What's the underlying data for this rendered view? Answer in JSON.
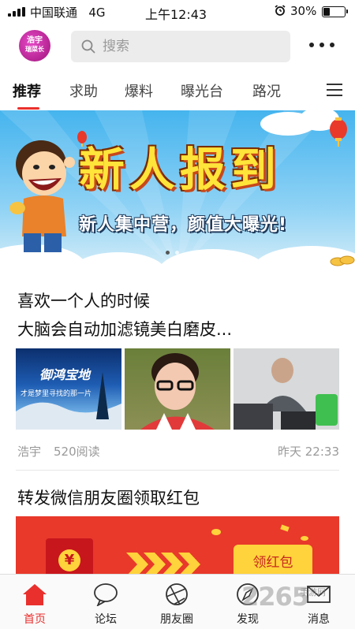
{
  "status_bar": {
    "carrier": "中国联通",
    "network": "4G",
    "time": "上午12:43",
    "battery": "30%",
    "battery_level": 0.3,
    "icons": [
      "signal-icon",
      "alarm-icon",
      "battery-icon"
    ]
  },
  "header": {
    "logo_text": "浩宇 | 瑞菜长",
    "search_placeholder": "搜索",
    "icons": [
      "search-icon",
      "more-icon"
    ]
  },
  "tabs": [
    {
      "label": "推荐",
      "active": true
    },
    {
      "label": "求助",
      "active": false
    },
    {
      "label": "爆料",
      "active": false
    },
    {
      "label": "曝光台",
      "active": false
    },
    {
      "label": "路况",
      "active": false
    }
  ],
  "banner": {
    "title": "新人报到",
    "subtitle": "新人集中营，颜值大曝光!",
    "slide_count": 2,
    "active_slide": 1
  },
  "article1": {
    "title_line1": "喜欢一个人的时候",
    "title_line2": "大脑会自动加滤镜美白磨皮...",
    "thumb1_caption": "御鸿宝地",
    "thumb1_small": "才是梦里寻找的那一片",
    "author": "浩宇",
    "reads": "520阅读",
    "time": "昨天 22:33"
  },
  "article2": {
    "title": "转发微信朋友圈领取红包",
    "promo_button": "领红包",
    "envelope_symbol": "¥"
  },
  "bottom_nav": [
    {
      "label": "首页",
      "icon": "home-icon",
      "active": true
    },
    {
      "label": "论坛",
      "icon": "chat-bubble-icon",
      "active": false
    },
    {
      "label": "朋友圈",
      "icon": "camera-aperture-icon",
      "active": false
    },
    {
      "label": "发现",
      "icon": "compass-icon",
      "active": false
    },
    {
      "label": "消息",
      "icon": "envelope-icon",
      "active": false
    }
  ],
  "watermark": {
    "text": "2265",
    "sub": "手游网"
  },
  "colors": {
    "accent": "#e9302d",
    "search_bg": "#ececec",
    "banner_sky": "#45b4ee",
    "banner_title": "#ffe43a",
    "promo_red": "#e8392b",
    "promo_button": "#ffd33b"
  }
}
